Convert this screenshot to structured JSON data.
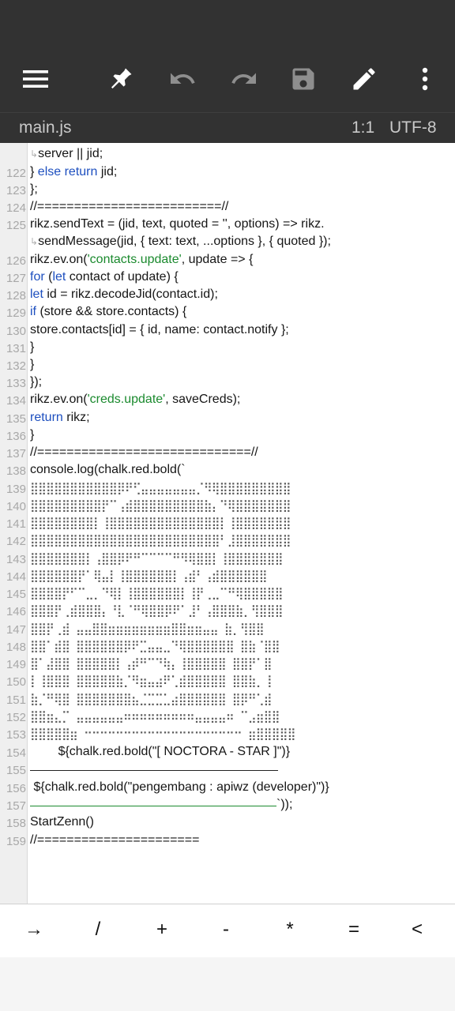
{
  "toolbar": {
    "icons": [
      "menu-icon",
      "pin-icon",
      "undo-icon",
      "redo-icon",
      "save-icon",
      "edit-icon",
      "more-icon"
    ]
  },
  "file": {
    "name": "main.js",
    "cursor": "1:1",
    "encoding": "UTF-8"
  },
  "lines": {
    "l121c": "server || jid;",
    "n122": "122",
    "l122a": "} ",
    "l122kw": "else return",
    "l122b": " jid;",
    "n123": "123",
    "l123": "};",
    "n124": "124",
    "l124": "//=========================//",
    "n125": "125",
    "l125": "rikz.sendText = (jid, text, quoted = '', options) => rikz.",
    "l125c": "sendMessage(jid, { text: text, ...options }, { quoted });",
    "n126": "126",
    "l126a": "rikz.ev.on(",
    "l126s": "'contacts.update'",
    "l126b": ", update => {",
    "n127": "127",
    "l127k1": "for",
    "l127a": " (",
    "l127k2": "let",
    "l127b": " contact of update) {",
    "n128": "128",
    "l128k": "let",
    "l128": " id = rikz.decodeJid(contact.id);",
    "n129": "129",
    "l129k": "if",
    "l129": " (store && store.contacts) {",
    "n130": "130",
    "l130": "store.contacts[id] = { id, name: contact.notify };",
    "n131": "131",
    "l131": "}",
    "n132": "132",
    "l132": "}",
    "n133": "133",
    "l133": "});",
    "n134": "134",
    "l134a": "rikz.ev.on(",
    "l134s": "'creds.update'",
    "l134b": ", saveCreds);",
    "n135": "135",
    "l135k": "return",
    "l135": " rikz;",
    "n136": "136",
    "l136": "}",
    "n137": "137",
    "l137": "//=============================//",
    "n138": "138",
    "l138": "console.log(chalk.red.bold(`",
    "n139": "139",
    "l139": "⣿⣿⣿⣿⣿⣿⣿⣿⣿⣿⣿⡿⠟⢋⣤⣤⣤⣤⣤⣤⣤⡈⠻⢿⣿⣿⣿⣿⣿⣿⣿⣿⣿",
    "n140": "140",
    "l140": "⣿⣿⣿⣿⣿⣿⣿⣿⣿⡟⠉⢠⣾⣿⣿⣿⣿⣿⣿⣿⣿⣿⣷⡄⠙⢿⣿⣿⣿⣿⣿⣿⣿",
    "n141": "141",
    "l141": "⣿⣿⣿⣿⣿⣿⣿⣿⡇⢸⣿⣿⣿⣿⣿⣿⣿⣿⣿⣿⣿⣿⣿⣿⡇⢸⣿⣿⣿⣿⣿⣿⣿",
    "n142": "142",
    "l142": "⣿⣿⣿⣿⣿⣿⣿⣿⣿⣿⣿⣿⣿⣿⣿⣿⣿⣿⣿⣿⣿⣿⣿⣿⠃⣸⣿⣿⣿⣿⣿⣿⣿",
    "n143": "143",
    "l143": "⣿⣿⣿⣿⣿⣿⣿⡇⢠⣿⣿⡿⠟⠛⠉⠉⠉⠉⠛⠻⢿⣿⣿⡇⢸⣿⣿⣿⣿⣿⣿⣿",
    "n144": "144",
    "l144": "⣿⣿⣿⣿⣿⣿⡟⠁⢿⣤⡇⢸⣿⣿⣿⣿⣿⣿⡇⢠⣾⠃⢠⣾⣿⣿⣿⣿⣿⣿",
    "n145": "145",
    "l145": "⣿⣿⣿⣿⡟⠋⠉⣀⡀⠙⢿⡇⢸⣿⣿⣿⣿⣿⣿⡇⢸⡟⢀⣀⠉⠛⢿⣿⣿⣿⣿⣿",
    "n146": "146",
    "l146": "⣿⣿⣿⡟⢀⣾⣿⣿⣿⡄⠘⣇⠈⠛⢿⣿⣿⡿⠟⠁⣸⠃⢠⣿⣿⣿⣷⡀⢻⣿⣿⣿",
    "n147": "147",
    "l147": "⣿⣿⡟⢀⣾ ⣤⣤⣿⣿⣶⣶⣶⣶⣶⣶⣶⣶⣿⣿⣶⣶⣤⣤ ⣷⡀⢻⣿⣿",
    "n148": "148",
    "l148": "⣿⣿⠁⣾⣿ ⣿⣿⣿⣿⣿⣿⡿⠟⣉⣤⣤⣀⠙⢿⣿⣿⣿⣿⣿⣿ ⣿⣷⠈⣿⣿",
    "n149": "149",
    "l149": "⣿⠁⣼⣿⣿ ⣿⣿⣿⣿⣿⡇⢠⡾⠛⠉⠙⢷⡄⢸⣿⣿⣿⣿⣿ ⣿⣿⡟⠁⣿",
    "n150": "150",
    "l150": "⡇⢸⣿⣿⣿ ⣿⣿⣿⣿⣿⣷⡈⠻⣶⣤⣴⠟⢁⣾⣿⣿⣿⣿⣿ ⣿⣿⣷⡀⢸",
    "n151": "151",
    "l151": "⣷⡈⠛⢿⣿ ⣿⣿⣿⣿⣿⣿⣿⣦⣈⣉⣉⣁⣴⣿⣿⣿⣿⣿⣿ ⣿⡿⠛⢁⣾",
    "n152": "152",
    "l152": "⣿⣿⣶⣄⡉ ⣤⣤⣤⣤⣤⣤⠶⠶⠶⠶⠶⠶⠶⠶⠶⣤⣤⣤⣤⠶ ⠉⣠⣶⣿⣿",
    "n153": "153",
    "l153": "⣿⣿⣿⣿⣿⣶ ⠒⠒⠒⠒⠒⠒⠒⠒⠒⠒⠒⠒⠒⠒⠒⠒⠒⠒⠒⠒ ⣶⣿⣿⣿⣿⣿",
    "n154": "154",
    "l154": "        ${chalk.red.bold(\"[ NOCTORA - STAR ]\")}",
    "n155": "155",
    "n156": "156",
    "l156": " ${chalk.red.bold(\"pengembang : apiwz (developer)\")}",
    "n157": "157",
    "l157": "`));",
    "n158": "158",
    "l158": "StartZenn()",
    "n159": "159",
    "l159": "//======================"
  },
  "keys": [
    "→",
    "/",
    "+",
    "-",
    "*",
    "=",
    "<"
  ]
}
